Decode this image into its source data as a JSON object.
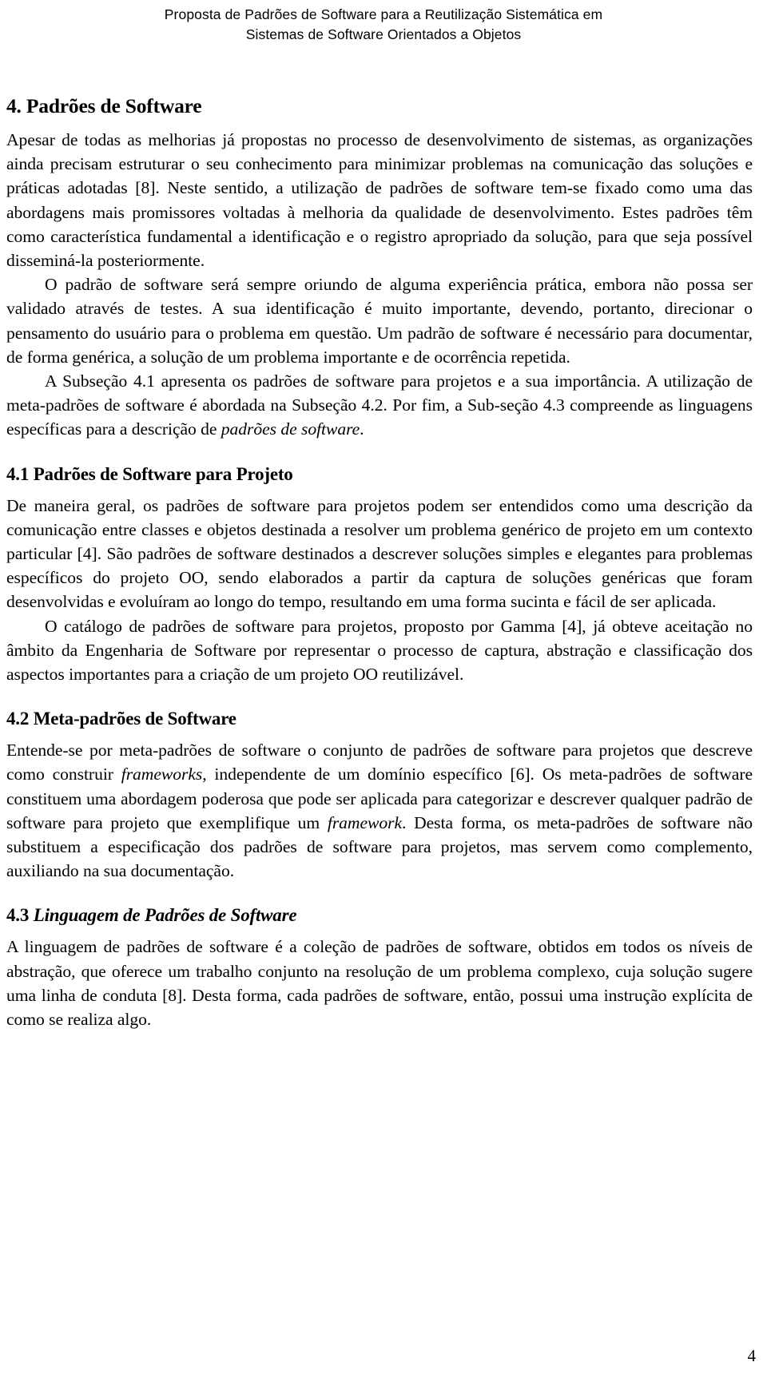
{
  "header": {
    "line1": "Proposta de Padrões de Software para a Reutilização Sistemática em",
    "line2": "Sistemas de Software Orientados a Objetos"
  },
  "section": {
    "number_and_title": "4. Padrões de Software",
    "paragraphs": {
      "p1": "Apesar de todas as melhorias já propostas no processo de desenvolvimento de sistemas, as organizações ainda precisam estruturar o seu conhecimento para minimizar problemas na comunicação das soluções e práticas adotadas [8]. Neste sentido, a utilização de padrões de software tem-se fixado como uma das abordagens mais promissores voltadas à melhoria da qualidade de desenvolvimento. Estes padrões têm como característica fundamental a identificação e o registro apropriado da solução, para que seja possível disseminá-la posteriormente.",
      "p2": "O padrão de software será sempre oriundo de alguma experiência prática, embora não possa ser validado através de testes. A sua identificação é muito importante, devendo, portanto, direcionar o pensamento do usuário para o problema em questão. Um padrão de software é necessário para documentar, de forma genérica, a solução de um problema importante e de ocorrência repetida.",
      "p3_part1": "A Subseção 4.1 apresenta os padrões de software para projetos e a sua importância. A utilização de meta-padrões de software é abordada na Subseção 4.2. Por fim, a Sub-seção 4.3 compreende as linguagens específicas para a descrição de ",
      "p3_italic": "padrões de software",
      "p3_part2": "."
    }
  },
  "subsection_41": {
    "number": "4.1",
    "title": "Padrões de Software para Projeto",
    "heading_full": "4.1 Padrões de Software para Projeto",
    "paragraphs": {
      "p1": "De maneira geral, os padrões de software para projetos podem ser entendidos como uma descrição da comunicação entre classes e objetos destinada a resolver um problema genérico de projeto em um contexto particular [4]. São padrões de software destinados a descrever soluções simples e elegantes para problemas específicos do projeto OO, sendo elaborados a partir da captura de soluções genéricas que foram desenvolvidas e evoluíram ao longo do tempo, resultando em uma forma sucinta e fácil de ser aplicada.",
      "p2": "O catálogo de padrões de software para projetos, proposto por Gamma [4], já obteve aceitação no âmbito da Engenharia de Software por representar o processo de captura, abstração e classificação dos aspectos importantes para a criação de um projeto OO reutilizável."
    }
  },
  "subsection_42": {
    "number": "4.2",
    "title": "Meta-padrões de Software",
    "heading_full": "4.2 Meta-padrões de Software",
    "paragraphs": {
      "p1_part1": "Entende-se por meta-padrões de software o conjunto de padrões de software para projetos que descreve como construir ",
      "p1_italic1": "frameworks",
      "p1_part2": ", independente de um domínio específico [6]. Os meta-padrões de software constituem uma abordagem poderosa que pode ser aplicada para categorizar e descrever qualquer padrão de software para projeto que exemplifique um ",
      "p1_italic2": "framework",
      "p1_part3": ". Desta forma, os meta-padrões de software não substituem a especificação dos padrões de software para projetos, mas servem como complemento, auxiliando na sua documentação."
    }
  },
  "subsection_43": {
    "number": "4.3",
    "title": "Linguagem de Padrões de Software",
    "paragraphs": {
      "p1": "A linguagem de padrões de software é a coleção de padrões de software, obtidos em todos os níveis de abstração, que oferece um trabalho conjunto na resolução de um problema complexo, cuja solução sugere uma linha de conduta [8]. Desta forma, cada padrões de software, então, possui uma instrução explícita de como se realiza algo."
    }
  },
  "footer": {
    "page_number": "4"
  }
}
